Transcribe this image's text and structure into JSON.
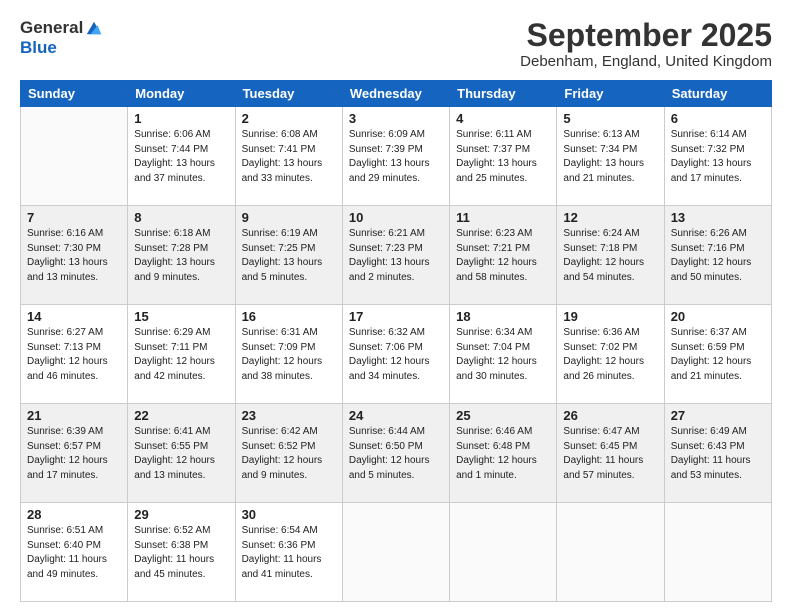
{
  "header": {
    "logo_general": "General",
    "logo_blue": "Blue",
    "month_title": "September 2025",
    "location": "Debenham, England, United Kingdom"
  },
  "days_of_week": [
    "Sunday",
    "Monday",
    "Tuesday",
    "Wednesday",
    "Thursday",
    "Friday",
    "Saturday"
  ],
  "weeks": [
    [
      {
        "day": "",
        "info": ""
      },
      {
        "day": "1",
        "info": "Sunrise: 6:06 AM\nSunset: 7:44 PM\nDaylight: 13 hours\nand 37 minutes."
      },
      {
        "day": "2",
        "info": "Sunrise: 6:08 AM\nSunset: 7:41 PM\nDaylight: 13 hours\nand 33 minutes."
      },
      {
        "day": "3",
        "info": "Sunrise: 6:09 AM\nSunset: 7:39 PM\nDaylight: 13 hours\nand 29 minutes."
      },
      {
        "day": "4",
        "info": "Sunrise: 6:11 AM\nSunset: 7:37 PM\nDaylight: 13 hours\nand 25 minutes."
      },
      {
        "day": "5",
        "info": "Sunrise: 6:13 AM\nSunset: 7:34 PM\nDaylight: 13 hours\nand 21 minutes."
      },
      {
        "day": "6",
        "info": "Sunrise: 6:14 AM\nSunset: 7:32 PM\nDaylight: 13 hours\nand 17 minutes."
      }
    ],
    [
      {
        "day": "7",
        "info": "Sunrise: 6:16 AM\nSunset: 7:30 PM\nDaylight: 13 hours\nand 13 minutes."
      },
      {
        "day": "8",
        "info": "Sunrise: 6:18 AM\nSunset: 7:28 PM\nDaylight: 13 hours\nand 9 minutes."
      },
      {
        "day": "9",
        "info": "Sunrise: 6:19 AM\nSunset: 7:25 PM\nDaylight: 13 hours\nand 5 minutes."
      },
      {
        "day": "10",
        "info": "Sunrise: 6:21 AM\nSunset: 7:23 PM\nDaylight: 13 hours\nand 2 minutes."
      },
      {
        "day": "11",
        "info": "Sunrise: 6:23 AM\nSunset: 7:21 PM\nDaylight: 12 hours\nand 58 minutes."
      },
      {
        "day": "12",
        "info": "Sunrise: 6:24 AM\nSunset: 7:18 PM\nDaylight: 12 hours\nand 54 minutes."
      },
      {
        "day": "13",
        "info": "Sunrise: 6:26 AM\nSunset: 7:16 PM\nDaylight: 12 hours\nand 50 minutes."
      }
    ],
    [
      {
        "day": "14",
        "info": "Sunrise: 6:27 AM\nSunset: 7:13 PM\nDaylight: 12 hours\nand 46 minutes."
      },
      {
        "day": "15",
        "info": "Sunrise: 6:29 AM\nSunset: 7:11 PM\nDaylight: 12 hours\nand 42 minutes."
      },
      {
        "day": "16",
        "info": "Sunrise: 6:31 AM\nSunset: 7:09 PM\nDaylight: 12 hours\nand 38 minutes."
      },
      {
        "day": "17",
        "info": "Sunrise: 6:32 AM\nSunset: 7:06 PM\nDaylight: 12 hours\nand 34 minutes."
      },
      {
        "day": "18",
        "info": "Sunrise: 6:34 AM\nSunset: 7:04 PM\nDaylight: 12 hours\nand 30 minutes."
      },
      {
        "day": "19",
        "info": "Sunrise: 6:36 AM\nSunset: 7:02 PM\nDaylight: 12 hours\nand 26 minutes."
      },
      {
        "day": "20",
        "info": "Sunrise: 6:37 AM\nSunset: 6:59 PM\nDaylight: 12 hours\nand 21 minutes."
      }
    ],
    [
      {
        "day": "21",
        "info": "Sunrise: 6:39 AM\nSunset: 6:57 PM\nDaylight: 12 hours\nand 17 minutes."
      },
      {
        "day": "22",
        "info": "Sunrise: 6:41 AM\nSunset: 6:55 PM\nDaylight: 12 hours\nand 13 minutes."
      },
      {
        "day": "23",
        "info": "Sunrise: 6:42 AM\nSunset: 6:52 PM\nDaylight: 12 hours\nand 9 minutes."
      },
      {
        "day": "24",
        "info": "Sunrise: 6:44 AM\nSunset: 6:50 PM\nDaylight: 12 hours\nand 5 minutes."
      },
      {
        "day": "25",
        "info": "Sunrise: 6:46 AM\nSunset: 6:48 PM\nDaylight: 12 hours\nand 1 minute."
      },
      {
        "day": "26",
        "info": "Sunrise: 6:47 AM\nSunset: 6:45 PM\nDaylight: 11 hours\nand 57 minutes."
      },
      {
        "day": "27",
        "info": "Sunrise: 6:49 AM\nSunset: 6:43 PM\nDaylight: 11 hours\nand 53 minutes."
      }
    ],
    [
      {
        "day": "28",
        "info": "Sunrise: 6:51 AM\nSunset: 6:40 PM\nDaylight: 11 hours\nand 49 minutes."
      },
      {
        "day": "29",
        "info": "Sunrise: 6:52 AM\nSunset: 6:38 PM\nDaylight: 11 hours\nand 45 minutes."
      },
      {
        "day": "30",
        "info": "Sunrise: 6:54 AM\nSunset: 6:36 PM\nDaylight: 11 hours\nand 41 minutes."
      },
      {
        "day": "",
        "info": ""
      },
      {
        "day": "",
        "info": ""
      },
      {
        "day": "",
        "info": ""
      },
      {
        "day": "",
        "info": ""
      }
    ]
  ]
}
